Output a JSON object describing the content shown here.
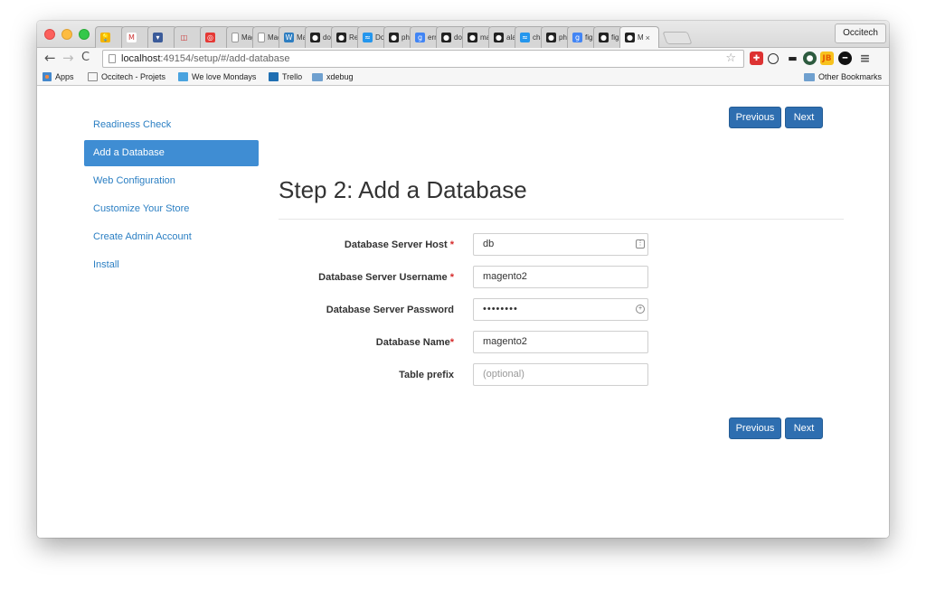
{
  "browser": {
    "tabs": [
      {
        "title": "",
        "icon": "keep-icon",
        "color": "#f4b400",
        "glyph": "💡"
      },
      {
        "title": "",
        "icon": "gmail-icon",
        "color": "#ffffff",
        "glyph": "M"
      },
      {
        "title": "",
        "icon": "shield-icon",
        "color": "#3b5b9a",
        "glyph": "▾"
      },
      {
        "title": "",
        "icon": "occitech-icon",
        "color": "#d6d6d6",
        "glyph": "◫"
      },
      {
        "title": "",
        "icon": "target-icon",
        "color": "#e53935",
        "glyph": "◎"
      },
      {
        "title": "Mag",
        "icon": "page-icon",
        "color": "#ffffff",
        "glyph": ""
      },
      {
        "title": "Mag",
        "icon": "page-icon",
        "color": "#ffffff",
        "glyph": ""
      },
      {
        "title": "Mag",
        "icon": "wordpress-icon",
        "color": "#2e7ec1",
        "glyph": "W"
      },
      {
        "title": "doci",
        "icon": "github-icon",
        "color": "#222222",
        "glyph": "●"
      },
      {
        "title": "Rele",
        "icon": "github-icon",
        "color": "#222222",
        "glyph": "●"
      },
      {
        "title": "Doc",
        "icon": "docker-icon",
        "color": "#2496ed",
        "glyph": "≈"
      },
      {
        "title": "php",
        "icon": "github-icon",
        "color": "#222222",
        "glyph": "●"
      },
      {
        "title": "erro",
        "icon": "google-icon",
        "color": "#4285f4",
        "glyph": "g"
      },
      {
        "title": "doci",
        "icon": "github-icon",
        "color": "#222222",
        "glyph": "●"
      },
      {
        "title": "mag",
        "icon": "github-icon",
        "color": "#222222",
        "glyph": "●"
      },
      {
        "title": "alan",
        "icon": "github-icon",
        "color": "#222222",
        "glyph": "●"
      },
      {
        "title": "char",
        "icon": "docker-icon",
        "color": "#2496ed",
        "glyph": "≈"
      },
      {
        "title": "php",
        "icon": "github-icon",
        "color": "#222222",
        "glyph": "●"
      },
      {
        "title": "fig f",
        "icon": "google-icon",
        "color": "#4285f4",
        "glyph": "g"
      },
      {
        "title": "fig u",
        "icon": "github-icon",
        "color": "#222222",
        "glyph": "●"
      }
    ],
    "active_tab": {
      "title": "M",
      "close": "×"
    },
    "profile": "Occitech",
    "url_host": "localhost",
    "url_rest": ":49154/setup/#/add-database",
    "bookmarks": {
      "apps": "Apps",
      "b1": "Occitech - Projets",
      "b2": "We love Mondays",
      "b3": "Trello",
      "b4": "xdebug",
      "other": "Other Bookmarks"
    }
  },
  "wizard": {
    "steps": [
      "Readiness Check",
      "Add a Database",
      "Web Configuration",
      "Customize Your Store",
      "Create Admin Account",
      "Install"
    ],
    "active_step": "Add a Database",
    "title": "Step 2: Add a Database",
    "previous_label": "Previous",
    "next_label": "Next",
    "fields": {
      "host": {
        "label": "Database Server Host",
        "required": "*",
        "value": "db"
      },
      "username": {
        "label": "Database Server Username",
        "required": "*",
        "value": "magento2"
      },
      "password": {
        "label": "Database Server Password",
        "required": "",
        "value": "••••••••"
      },
      "dbname": {
        "label": "Database Name",
        "required": "*",
        "value": "magento2"
      },
      "prefix": {
        "label": "Table prefix",
        "required": "",
        "value": "",
        "placeholder": "(optional)"
      }
    }
  },
  "colors": {
    "accent": "#3f8dd3",
    "button": "#2e6eb0",
    "link": "#2b7fc3",
    "required": "#d62b2b"
  }
}
